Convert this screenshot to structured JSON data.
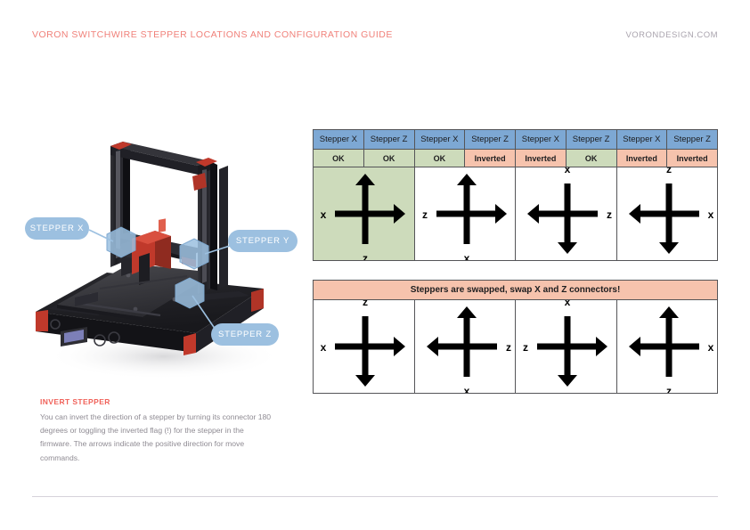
{
  "header": {
    "title": "VORON SWITCHWIRE STEPPER LOCATIONS AND CONFIGURATION GUIDE",
    "site": "VORONDESIGN.COM",
    "title_color": "#f0817a",
    "site_color": "#a9a3ad"
  },
  "render": {
    "alt": "voron-switchwire-3d-render",
    "callouts": [
      {
        "id": "stepper-x",
        "label": "STEPPER X"
      },
      {
        "id": "stepper-y",
        "label": "STEPPER Y"
      },
      {
        "id": "stepper-z",
        "label": "STEPPER Z"
      }
    ],
    "pill_color": "#9cc0e0",
    "marker_color": "#9cc0e0",
    "frame_color": "#1b1b1e",
    "accent_color": "#c0392b"
  },
  "note": {
    "title": "INVERT STEPPER",
    "body": "You can invert the direction of a stepper by turning its connector 180 degrees or toggling the inverted flag (!) for the stepper in the firmware. The arrows indicate the positive direction for move commands.",
    "title_color": "#f0625a",
    "body_color": "#8f8b93"
  },
  "colors": {
    "header_blue": "#7da8d4",
    "ok_green": "#cddbbb",
    "inverted_salmon": "#f6c3ad",
    "border": "#555558",
    "arrow": "#000000"
  },
  "tables": [
    {
      "id": "stepper-status-table",
      "banner": null,
      "columns": [
        {
          "header": "Stepper X",
          "status": "OK"
        },
        {
          "header": "Stepper Z",
          "status": "OK"
        },
        {
          "header": "Stepper X",
          "status": "OK"
        },
        {
          "header": "Stepper Z",
          "status": "Inverted"
        },
        {
          "header": "Stepper X",
          "status": "Inverted"
        },
        {
          "header": "Stepper Z",
          "status": "OK"
        },
        {
          "header": "Stepper X",
          "status": "Inverted"
        },
        {
          "header": "Stepper Z",
          "status": "Inverted"
        }
      ],
      "diagrams": [
        {
          "horizontal": "right",
          "vertical": "up",
          "h_label": "x",
          "v_label": "z",
          "highlight": true
        },
        {
          "horizontal": "right",
          "vertical": "up",
          "h_label": "z",
          "v_label": "x",
          "highlight": false
        },
        {
          "horizontal": "left",
          "vertical": "down",
          "h_label": "z",
          "v_label": "x",
          "highlight": false
        },
        {
          "horizontal": "left",
          "vertical": "down",
          "h_label": "x",
          "v_label": "z",
          "highlight": false
        }
      ]
    },
    {
      "id": "steppers-swapped-table",
      "banner": "Steppers are swapped, swap X and Z connectors!",
      "columns": [],
      "diagrams": [
        {
          "horizontal": "right",
          "vertical": "down",
          "h_label": "x",
          "v_label": "z",
          "highlight": false
        },
        {
          "horizontal": "left",
          "vertical": "up",
          "h_label": "z",
          "v_label": "x",
          "highlight": false
        },
        {
          "horizontal": "right",
          "vertical": "down",
          "h_label": "z",
          "v_label": "x",
          "highlight": false
        },
        {
          "horizontal": "left",
          "vertical": "up",
          "h_label": "x",
          "v_label": "z",
          "highlight": false
        }
      ]
    }
  ]
}
